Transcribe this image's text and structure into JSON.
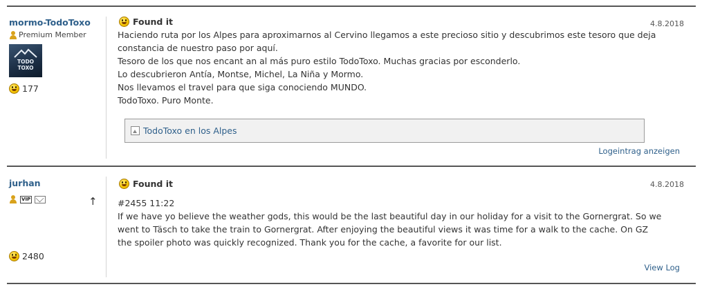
{
  "logs": [
    {
      "username": "mormo-TodoToxo",
      "rank": "Premium Member",
      "avatar_text_top": "TODO",
      "avatar_text_bottom": "TOXO",
      "found_count": "177",
      "log_type": "Found it",
      "date": "4.8.2018",
      "text_lines": [
        "Haciendo ruta por los Alpes para aproximarnos al Cervino llegamos a este precioso sitio y descubrimos este tesoro que deja",
        "constancia de nuestro paso por aquí.",
        "Tesoro de los que nos encant an al más puro estilo TodoToxo. Muchas gracias por esconderlo.",
        "Lo descubrieron Antía, Montse, Michel, La Niña y Mormo.",
        "Nos llevamos el travel para que siga conociendo MUNDO.",
        "TodoToxo. Puro Monte."
      ],
      "image_link": "TodoToxo en los Alpes",
      "view_log": "Logeintrag anzeigen"
    },
    {
      "username": "jurhan",
      "vip_badge": "VIP",
      "sort_arrow": "↑",
      "found_count": "2480",
      "log_type": "Found it",
      "date": "4.8.2018",
      "text_lines": [
        "#2455 11:22",
        "If we have yo believe the weather gods, this would be the last beautiful day in our holiday for a visit to the Gornergrat. So we",
        "went to Täsch to take the train to Gornergrat. After enjoying the beautiful views it was time for a walk to the cache. On GZ",
        "the spoiler photo was quickly recognized. Thank you for the cache, a favorite for our list."
      ],
      "view_log": "View Log"
    }
  ],
  "colors": {
    "link": "#2e5f8a",
    "divider": "#555555",
    "smiley": "#f5c400",
    "member_icon": "#d9a21b"
  },
  "icons": [
    "member-icon",
    "smiley-icon",
    "image-icon",
    "vip-icon",
    "mail-icon",
    "arrow-up-icon"
  ]
}
